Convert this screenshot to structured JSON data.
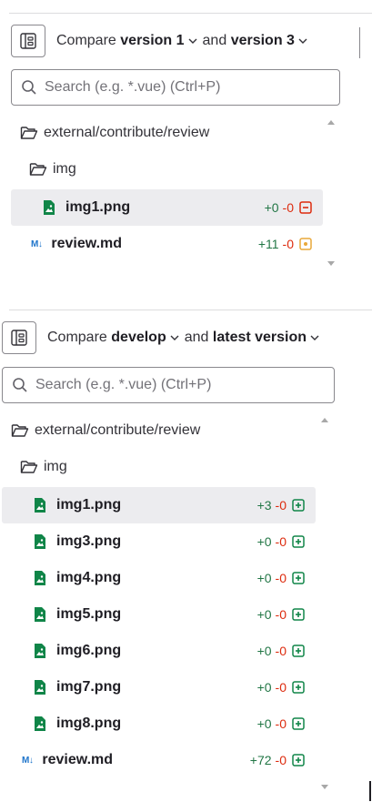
{
  "panel1": {
    "compare_label": "Compare",
    "from_version": "version 1",
    "and_label": "and",
    "to_version": "version 3",
    "search_placeholder": "Search (e.g. *.vue) (Ctrl+P)",
    "tree": {
      "root_folder": "external/contribute/review",
      "sub_folder": "img",
      "files": [
        {
          "name": "img1.png",
          "added": "+0",
          "removed": "-0",
          "status": "deleted",
          "selected": true
        },
        {
          "name": "review.md",
          "added": "+11",
          "removed": "-0",
          "status": "modified",
          "selected": false
        }
      ]
    }
  },
  "panel2": {
    "compare_label": "Compare",
    "from_version": "develop",
    "and_label": "and",
    "to_version": "latest version",
    "search_placeholder": "Search (e.g. *.vue) (Ctrl+P)",
    "tree": {
      "root_folder": "external/contribute/review",
      "sub_folder": "img",
      "files": [
        {
          "name": "img1.png",
          "added": "+3",
          "removed": "-0",
          "status": "added",
          "selected": true
        },
        {
          "name": "img3.png",
          "added": "+0",
          "removed": "-0",
          "status": "added",
          "selected": false
        },
        {
          "name": "img4.png",
          "added": "+0",
          "removed": "-0",
          "status": "added",
          "selected": false
        },
        {
          "name": "img5.png",
          "added": "+0",
          "removed": "-0",
          "status": "added",
          "selected": false
        },
        {
          "name": "img6.png",
          "added": "+0",
          "removed": "-0",
          "status": "added",
          "selected": false
        },
        {
          "name": "img7.png",
          "added": "+0",
          "removed": "-0",
          "status": "added",
          "selected": false
        },
        {
          "name": "img8.png",
          "added": "+0",
          "removed": "-0",
          "status": "added",
          "selected": false
        },
        {
          "name": "review.md",
          "added": "+72",
          "removed": "-0",
          "status": "added",
          "selected": false
        }
      ]
    }
  },
  "icons": {
    "tree_toggle": "file-tree-icon",
    "search": "search-icon",
    "folder": "folder-open-icon",
    "image_file": "file-image-icon",
    "markdown_file": "markdown-icon",
    "chevron": "chevron-down-icon",
    "markdown_glyph": "M↓"
  },
  "colors": {
    "added": "#217645",
    "removed": "#dd2b0e",
    "modified": "#e9a83a",
    "markdown": "#1f75cb",
    "image_icon": "#108548"
  }
}
